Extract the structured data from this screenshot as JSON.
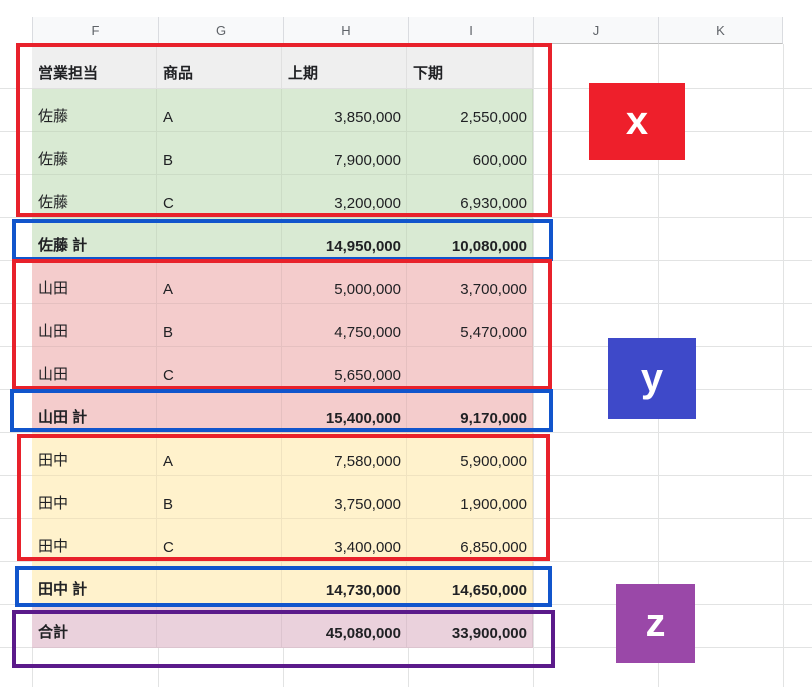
{
  "columns": [
    "F",
    "G",
    "H",
    "I",
    "J",
    "K"
  ],
  "headers": [
    "営業担当",
    "商品",
    "上期",
    "下期"
  ],
  "rows": [
    {
      "rep": "佐藤",
      "product": "A",
      "h1": "3,850,000",
      "h2": "2,550,000"
    },
    {
      "rep": "佐藤",
      "product": "B",
      "h1": "7,900,000",
      "h2": "600,000"
    },
    {
      "rep": "佐藤",
      "product": "C",
      "h1": "3,200,000",
      "h2": "6,930,000"
    },
    {
      "rep": "佐藤 計",
      "product": "",
      "h1": "14,950,000",
      "h2": "10,080,000"
    },
    {
      "rep": "山田",
      "product": "A",
      "h1": "5,000,000",
      "h2": "3,700,000"
    },
    {
      "rep": "山田",
      "product": "B",
      "h1": "4,750,000",
      "h2": "5,470,000"
    },
    {
      "rep": "山田",
      "product": "C",
      "h1": "5,650,000",
      "h2": ""
    },
    {
      "rep": "山田 計",
      "product": "",
      "h1": "15,400,000",
      "h2": "9,170,000"
    },
    {
      "rep": "田中",
      "product": "A",
      "h1": "7,580,000",
      "h2": "5,900,000"
    },
    {
      "rep": "田中",
      "product": "B",
      "h1": "3,750,000",
      "h2": "1,900,000"
    },
    {
      "rep": "田中",
      "product": "C",
      "h1": "3,400,000",
      "h2": "6,850,000"
    },
    {
      "rep": "田中 計",
      "product": "",
      "h1": "14,730,000",
      "h2": "14,650,000"
    },
    {
      "rep": "合計",
      "product": "",
      "h1": "45,080,000",
      "h2": "33,900,000"
    }
  ],
  "annotations": {
    "x": {
      "text": "x",
      "color": "#ee1f2b"
    },
    "y": {
      "text": "y",
      "color": "#3e49c9"
    },
    "z": {
      "text": "z",
      "color": "#9a48a8"
    }
  },
  "colors": {
    "header_fill": "#efefef",
    "sato_fill": "#d9ead3",
    "yamada_fill": "#f4cccc",
    "tanaka_fill": "#fff2cc",
    "total_fill": "#ead1dc",
    "red_box": "#e8212b",
    "blue_box": "#1155cc",
    "purple_box": "#5b1a8a"
  }
}
